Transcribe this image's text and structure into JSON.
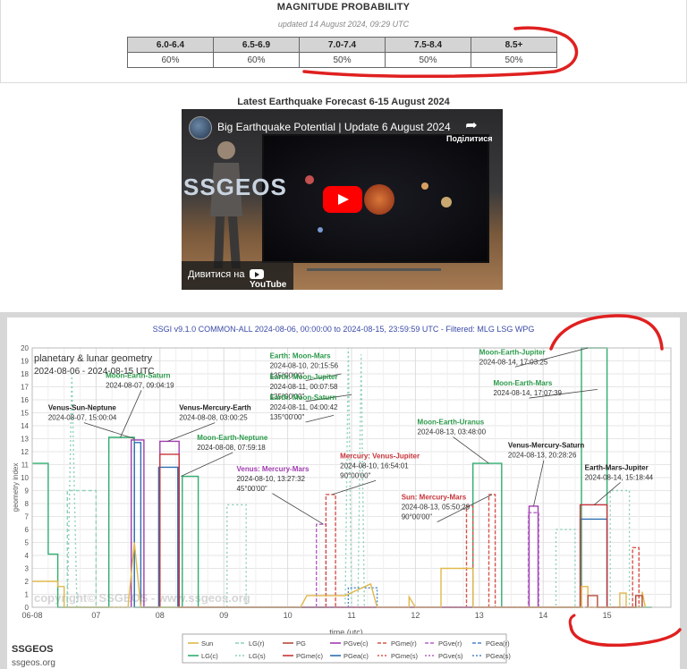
{
  "magnitude": {
    "title": "MAGNITUDE PROBABILITY",
    "updated": "updated 14 August 2024, 09:29 UTC",
    "headers": [
      "6.0-6.4",
      "6.5-6.9",
      "7.0-7.4",
      "7.5-8.4",
      "8.5+"
    ],
    "values": [
      "60%",
      "60%",
      "50%",
      "50%",
      "50%"
    ]
  },
  "video": {
    "section_title": "Latest Earthquake Forecast 6-15 August 2024",
    "title": "Big Earthquake Potential | Update 6 August 2024",
    "share_label": "Поділитися",
    "watch_on": "Дивитися на",
    "youtube": "YouTube",
    "channel_logo": "SSGEOS"
  },
  "chart_data": {
    "type": "line",
    "title": "SSGI v9.1.0 COMMON-ALL 2024-08-06, 00:00:00 to 2024-08-15, 23:59:59 UTC - Filtered: MLG LSG WPG",
    "ylabel": "geometry index",
    "xlabel": "time (utc)",
    "ylim": [
      0,
      20
    ],
    "xlim": [
      6,
      16
    ],
    "x_ticks": [
      "06-08",
      "07",
      "08",
      "09",
      "10",
      "11",
      "12",
      "13",
      "14",
      "15"
    ],
    "y_ticks": [
      "0",
      "1",
      "2",
      "3",
      "4",
      "5",
      "6",
      "7",
      "8",
      "9",
      "10",
      "11",
      "12",
      "13",
      "14",
      "15",
      "16",
      "17",
      "18",
      "19",
      "20"
    ],
    "grid": true,
    "box_title": "planetary & lunar geometry",
    "box_range": "2024-08-06 - 2024-08-15 UTC",
    "watermark": "copyright© SSGEOS - www.ssgeos.org",
    "legend": [
      {
        "name": "Sun",
        "color": "#e0b84a",
        "dash": ""
      },
      {
        "name": "LG(c)",
        "color": "#2fae6f",
        "dash": ""
      },
      {
        "name": "LG(r)",
        "color": "#8ed1b8",
        "dash": "4,2"
      },
      {
        "name": "LG(s)",
        "color": "#8ed1b8",
        "dash": "2,2"
      },
      {
        "name": "PG",
        "color": "#b94a3a",
        "dash": ""
      },
      {
        "name": "PGme(c)",
        "color": "#c8343a",
        "dash": ""
      },
      {
        "name": "PGve(c)",
        "color": "#a03cb0",
        "dash": ""
      },
      {
        "name": "PGea(c)",
        "color": "#2d6fb0",
        "dash": ""
      },
      {
        "name": "PGme(r)",
        "color": "#d8534c",
        "dash": "4,2"
      },
      {
        "name": "PGme(s)",
        "color": "#d8534c",
        "dash": "2,2"
      },
      {
        "name": "PGve(r)",
        "color": "#b563c4",
        "dash": "4,2"
      },
      {
        "name": "PGve(s)",
        "color": "#b563c4",
        "dash": "2,2"
      },
      {
        "name": "PGea(r)",
        "color": "#4a86c8",
        "dash": "4,2"
      },
      {
        "name": "PGea(s)",
        "color": "#4a86c8",
        "dash": "2,2"
      }
    ],
    "series": [
      {
        "name": "LG(c)",
        "color": "#2fae6f",
        "dash": "",
        "points": [
          [
            6.0,
            11.1
          ],
          [
            6.25,
            11.1
          ],
          [
            6.25,
            4.1
          ],
          [
            6.4,
            4.1
          ],
          [
            6.4,
            0
          ],
          [
            7.2,
            0
          ],
          [
            7.2,
            13.1
          ],
          [
            7.6,
            13.1
          ],
          [
            7.6,
            0
          ],
          [
            8.35,
            0
          ],
          [
            8.35,
            10.1
          ],
          [
            8.6,
            10.1
          ],
          [
            8.6,
            0
          ],
          [
            12.9,
            0
          ],
          [
            12.9,
            11.1
          ],
          [
            13.35,
            11.1
          ],
          [
            13.35,
            0
          ],
          [
            14.6,
            0
          ],
          [
            14.6,
            20
          ],
          [
            15.0,
            20
          ],
          [
            15.0,
            0
          ],
          [
            15.7,
            0
          ]
        ]
      },
      {
        "name": "LG(r)",
        "color": "#8ed1b8",
        "dash": "4,3",
        "points": [
          [
            6.55,
            0
          ],
          [
            6.55,
            9
          ],
          [
            7.0,
            9
          ],
          [
            7.0,
            0
          ]
        ]
      },
      {
        "name": "LG(s)",
        "color": "#8ed1b8",
        "dash": "2,3",
        "points": [
          [
            6.55,
            0
          ],
          [
            6.62,
            18
          ],
          [
            6.7,
            0
          ],
          [
            9.05,
            0
          ],
          [
            9.05,
            7.9
          ],
          [
            9.35,
            7.9
          ],
          [
            9.35,
            0
          ],
          [
            10.9,
            0
          ],
          [
            10.95,
            20
          ],
          [
            11.0,
            0
          ],
          [
            11.1,
            0
          ],
          [
            11.15,
            19.5
          ],
          [
            11.2,
            0
          ],
          [
            14.2,
            0
          ],
          [
            14.2,
            6
          ],
          [
            14.5,
            6
          ],
          [
            14.5,
            0
          ],
          [
            15.05,
            0
          ],
          [
            15.05,
            9
          ],
          [
            15.35,
            9
          ],
          [
            15.35,
            0
          ]
        ]
      },
      {
        "name": "PGve(c)",
        "color": "#a03cb0",
        "dash": "",
        "points": [
          [
            7.55,
            0
          ],
          [
            7.55,
            12.9
          ],
          [
            7.75,
            12.9
          ],
          [
            7.75,
            0
          ],
          [
            8.0,
            0
          ],
          [
            8.0,
            12.8
          ],
          [
            8.3,
            12.8
          ],
          [
            8.3,
            0
          ],
          [
            13.78,
            0
          ],
          [
            13.78,
            7.8
          ],
          [
            13.92,
            7.8
          ],
          [
            13.92,
            0
          ]
        ]
      },
      {
        "name": "PGea(c)",
        "color": "#2d6fb0",
        "dash": "",
        "points": [
          [
            7.6,
            0
          ],
          [
            7.6,
            12.7
          ],
          [
            7.7,
            12.7
          ],
          [
            7.7,
            0
          ],
          [
            7.98,
            0
          ],
          [
            7.98,
            10.8
          ],
          [
            8.28,
            10.8
          ],
          [
            8.28,
            0
          ],
          [
            14.58,
            0
          ],
          [
            14.58,
            6.8
          ],
          [
            15.0,
            6.8
          ],
          [
            15.0,
            0
          ]
        ]
      },
      {
        "name": "PGme(c)",
        "color": "#c8343a",
        "dash": "",
        "points": [
          [
            8.0,
            0
          ],
          [
            8.0,
            11.8
          ],
          [
            8.3,
            11.8
          ],
          [
            8.3,
            0
          ],
          [
            14.58,
            0
          ],
          [
            14.58,
            7.9
          ],
          [
            15.0,
            7.9
          ],
          [
            15.0,
            0
          ]
        ]
      },
      {
        "name": "PGve(r)",
        "color": "#b563c4",
        "dash": "4,2",
        "points": [
          [
            10.45,
            0
          ],
          [
            10.45,
            6.4
          ],
          [
            10.6,
            6.4
          ],
          [
            10.6,
            0
          ],
          [
            13.77,
            0
          ],
          [
            13.77,
            7.3
          ],
          [
            13.93,
            7.3
          ],
          [
            13.93,
            0
          ]
        ]
      },
      {
        "name": "PGme(r)",
        "color": "#d8534c",
        "dash": "4,2",
        "points": [
          [
            10.6,
            0
          ],
          [
            10.6,
            8.7
          ],
          [
            10.75,
            8.7
          ],
          [
            10.75,
            0
          ],
          [
            12.8,
            0
          ],
          [
            12.8,
            7.8
          ],
          [
            12.9,
            7.8
          ],
          [
            12.9,
            0
          ],
          [
            13.15,
            0
          ],
          [
            13.15,
            8.7
          ],
          [
            13.25,
            8.7
          ],
          [
            13.25,
            0
          ],
          [
            15.4,
            0
          ],
          [
            15.4,
            4.6
          ],
          [
            15.5,
            4.6
          ],
          [
            15.5,
            0
          ]
        ]
      },
      {
        "name": "PGea(s)",
        "color": "#4a86c8",
        "dash": "2,2",
        "points": [
          [
            10.95,
            0
          ],
          [
            10.95,
            1.5
          ],
          [
            11.4,
            1.5
          ],
          [
            11.4,
            0
          ]
        ]
      },
      {
        "name": "Sun",
        "color": "#e0b84a",
        "dash": "",
        "points": [
          [
            6.0,
            2
          ],
          [
            6.4,
            2
          ],
          [
            6.4,
            1.6
          ],
          [
            6.5,
            1.6
          ],
          [
            6.5,
            0
          ],
          [
            7.5,
            0
          ],
          [
            7.6,
            5
          ],
          [
            7.7,
            0
          ],
          [
            10.2,
            0
          ],
          [
            10.3,
            0.9
          ],
          [
            10.9,
            0.9
          ],
          [
            11.3,
            1.8
          ],
          [
            11.4,
            0
          ],
          [
            11.9,
            0
          ],
          [
            11.9,
            0.8
          ],
          [
            12.0,
            0
          ],
          [
            12.4,
            0
          ],
          [
            12.4,
            3
          ],
          [
            12.9,
            3
          ],
          [
            12.9,
            0
          ],
          [
            14.6,
            0
          ],
          [
            14.6,
            1.6
          ],
          [
            14.7,
            1.6
          ],
          [
            14.7,
            0
          ],
          [
            15.2,
            0
          ],
          [
            15.2,
            1.1
          ],
          [
            15.3,
            1.1
          ],
          [
            15.3,
            0
          ],
          [
            15.55,
            0
          ],
          [
            15.55,
            1.2
          ],
          [
            15.6,
            0
          ]
        ]
      },
      {
        "name": "PG",
        "color": "#b94a3a",
        "dash": "",
        "points": [
          [
            14.7,
            0
          ],
          [
            14.7,
            0.9
          ],
          [
            14.85,
            0.9
          ],
          [
            14.85,
            0
          ],
          [
            15.45,
            0
          ],
          [
            15.45,
            0.9
          ],
          [
            15.55,
            0.9
          ],
          [
            15.55,
            0
          ]
        ]
      }
    ],
    "annotations": [
      {
        "id": "venus-sun-neptune",
        "title": "Venus-Sun-Neptune",
        "date": "2024-08-07, 15:00:04",
        "angle": "",
        "color": "#222222",
        "x": 7.6,
        "y": 13.0,
        "tx": 6.25,
        "ty": 15.2,
        "align": "start"
      },
      {
        "id": "moon-earth-saturn",
        "title": "Moon-Earth-Saturn",
        "date": "2024-08-07, 09:04:19",
        "angle": "",
        "color": "#2b9a4a",
        "x": 7.38,
        "y": 13.1,
        "tx": 7.15,
        "ty": 17.7,
        "align": "start"
      },
      {
        "id": "venus-mercury-earth",
        "title": "Venus-Mercury-Earth",
        "date": "2024-08-08, 03:00:25",
        "angle": "",
        "color": "#222222",
        "x": 8.12,
        "y": 12.8,
        "tx": 8.3,
        "ty": 15.2,
        "align": "start"
      },
      {
        "id": "moon-earth-neptune",
        "title": "Moon-Earth-Neptune",
        "date": "2024-08-08, 07:59:18",
        "angle": "",
        "color": "#2b9a4a",
        "x": 8.33,
        "y": 10.1,
        "tx": 8.58,
        "ty": 12.9,
        "align": "start"
      },
      {
        "id": "earth-moon-mars",
        "title": "Earth: Moon-Mars",
        "date": "2024-08-10, 20:15:56",
        "angle": "135°00'00\"",
        "color": "#2b9a4a",
        "x": 10.84,
        "y": 18.0,
        "tx": 9.72,
        "ty": 19.2,
        "align": "start"
      },
      {
        "id": "earth-moon-jupiter",
        "title": "Earth: Moon-Jupiter",
        "date": "2024-08-11, 00:07:58",
        "angle": "135°00'00\"",
        "color": "#2b9a4a",
        "x": 11.0,
        "y": 16.4,
        "tx": 9.72,
        "ty": 17.6,
        "align": "start"
      },
      {
        "id": "earth-moon-saturn",
        "title": "Earth: Moon-Saturn",
        "date": "2024-08-11, 04:00:42",
        "angle": "135°00'00\"",
        "color": "#2b9a4a",
        "x": 10.72,
        "y": 14.8,
        "tx": 9.72,
        "ty": 16.0,
        "align": "start"
      },
      {
        "id": "venus-mercury-mars",
        "title": "Venus: Mercury-Mars",
        "date": "2024-08-10, 13:27:32",
        "angle": "45°00'00\"",
        "color": "#a03cb0",
        "x": 10.56,
        "y": 6.4,
        "tx": 9.2,
        "ty": 10.5,
        "align": "start"
      },
      {
        "id": "mercury-venus-jupiter",
        "title": "Mercury: Venus-Jupiter",
        "date": "2024-08-10, 16:54:01",
        "angle": "90°00'00\"",
        "color": "#c8343a",
        "x": 10.7,
        "y": 8.7,
        "tx": 10.82,
        "ty": 11.5,
        "align": "start"
      },
      {
        "id": "moon-earth-jupiter",
        "title": "Moon-Earth-Jupiter",
        "date": "2024-08-14, 17:03:25",
        "angle": "",
        "color": "#2b9a4a",
        "x": 14.7,
        "y": 20,
        "tx": 13.0,
        "ty": 19.5,
        "align": "start"
      },
      {
        "id": "moon-earth-mars",
        "title": "Moon-Earth-Mars",
        "date": "2024-08-14, 17:07:39",
        "angle": "",
        "color": "#2b9a4a",
        "x": 14.85,
        "y": 16.8,
        "tx": 13.22,
        "ty": 17.1,
        "align": "start"
      },
      {
        "id": "moon-earth-uranus",
        "title": "Moon-Earth-Uranus",
        "date": "2024-08-13, 03:48:00",
        "angle": "",
        "color": "#2b9a4a",
        "x": 13.15,
        "y": 11.1,
        "tx": 12.03,
        "ty": 14.1,
        "align": "start"
      },
      {
        "id": "venus-mercury-saturn",
        "title": "Venus-Mercury-Saturn",
        "date": "2024-08-13, 20:28:26",
        "angle": "",
        "color": "#222222",
        "x": 13.85,
        "y": 7.8,
        "tx": 13.45,
        "ty": 12.3,
        "align": "start"
      },
      {
        "id": "sun-mercury-mars",
        "title": "Sun: Mercury-Mars",
        "date": "2024-08-13, 05:50:29",
        "angle": "90°00'00\"",
        "color": "#c8343a",
        "x": 13.2,
        "y": 8.7,
        "tx": 11.78,
        "ty": 8.3,
        "align": "start"
      },
      {
        "id": "earth-mars-jupiter",
        "title": "Earth-Mars-Jupiter",
        "date": "2024-08-14, 15:18:44",
        "angle": "",
        "color": "#222222",
        "x": 14.8,
        "y": 7.9,
        "tx": 14.65,
        "ty": 10.6,
        "align": "start"
      }
    ]
  },
  "footer": {
    "brand": "SSGEOS",
    "url": "ssgeos.org"
  }
}
